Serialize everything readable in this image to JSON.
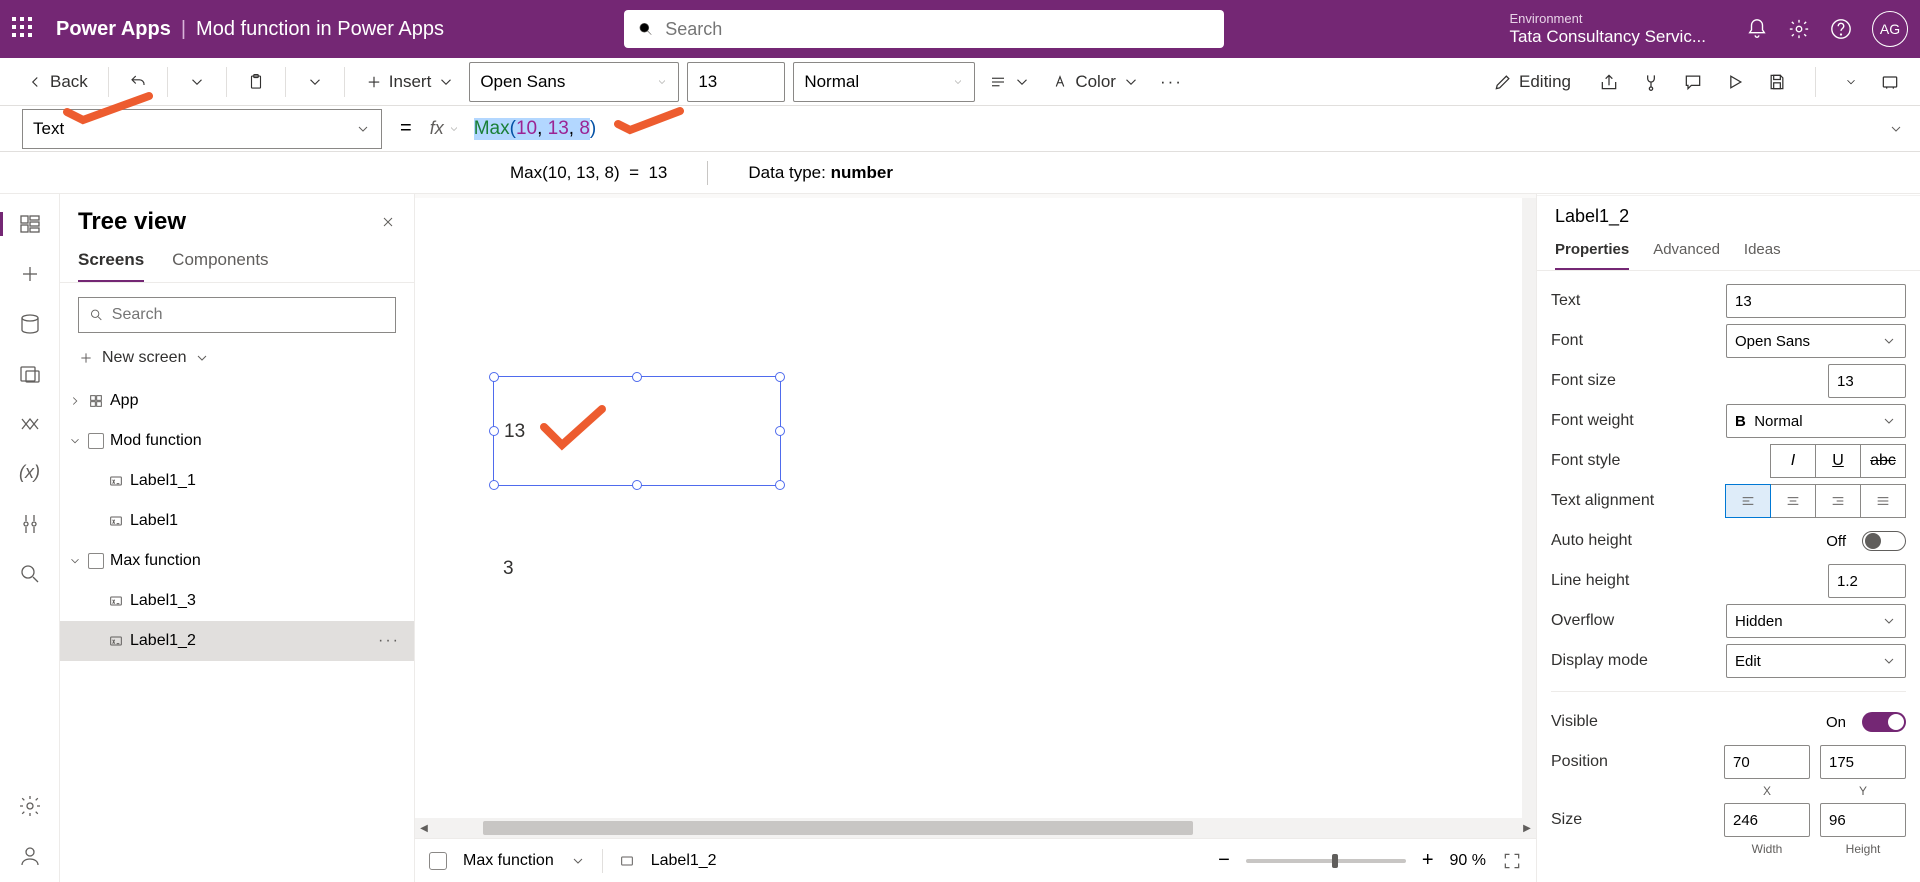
{
  "header": {
    "appName": "Power Apps",
    "separator": "|",
    "fileName": "Mod function in Power Apps",
    "searchPlaceholder": "Search",
    "envLabel": "Environment",
    "envValue": "Tata Consultancy Servic...",
    "avatar": "AG"
  },
  "cmd": {
    "back": "Back",
    "insert": "Insert",
    "font": "Open Sans",
    "size": "13",
    "weight": "Normal",
    "color": "Color",
    "editing": "Editing"
  },
  "formula": {
    "property": "Text",
    "fxLabel": "fx",
    "fn": "Max",
    "args": [
      "10",
      "13",
      "8"
    ],
    "resultExpr": "Max(10, 13, 8)",
    "resultEq": "=",
    "resultVal": "13",
    "dataTypeLabel": "Data type:",
    "dataTypeValue": "number"
  },
  "treeView": {
    "title": "Tree view",
    "tabs": [
      "Screens",
      "Components"
    ],
    "searchPlaceholder": "Search",
    "newScreen": "New screen",
    "items": {
      "app": "App",
      "screen1": "Mod function",
      "l11": "Label1_1",
      "l1": "Label1",
      "screen2": "Max function",
      "l13": "Label1_3",
      "l12": "Label1_2"
    }
  },
  "canvas": {
    "selectedText": "13",
    "otherText": "3",
    "footerScreen": "Max function",
    "footerControl": "Label1_2",
    "zoom": "90",
    "zoomUnit": "%"
  },
  "props": {
    "controlName": "Label1_2",
    "tabs": [
      "Properties",
      "Advanced",
      "Ideas"
    ],
    "text": {
      "label": "Text",
      "value": "13"
    },
    "font": {
      "label": "Font",
      "value": "Open Sans"
    },
    "fontSize": {
      "label": "Font size",
      "value": "13"
    },
    "fontWeight": {
      "label": "Font weight",
      "value": "Normal",
      "prefix": "B"
    },
    "fontStyle": {
      "label": "Font style"
    },
    "textAlign": {
      "label": "Text alignment"
    },
    "autoHeight": {
      "label": "Auto height",
      "value": "Off"
    },
    "lineHeight": {
      "label": "Line height",
      "value": "1.2"
    },
    "overflow": {
      "label": "Overflow",
      "value": "Hidden"
    },
    "displayMode": {
      "label": "Display mode",
      "value": "Edit"
    },
    "visible": {
      "label": "Visible",
      "value": "On"
    },
    "position": {
      "label": "Position",
      "x": "70",
      "y": "175",
      "xl": "X",
      "yl": "Y"
    },
    "size": {
      "label": "Size",
      "w": "246",
      "h": "96",
      "wl": "Width",
      "hl": "Height"
    }
  }
}
